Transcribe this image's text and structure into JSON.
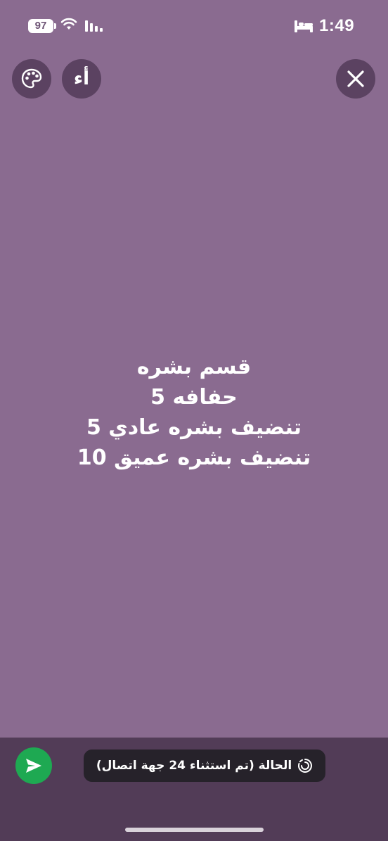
{
  "status_bar": {
    "battery_level": "97",
    "time": "1:49",
    "icons": [
      "wifi-icon",
      "signal-icon",
      "sleep-focus-icon"
    ]
  },
  "toolbar": {
    "font_button_label": "أء",
    "palette_icon": "palette-icon",
    "close_icon": "close-icon"
  },
  "status_text": {
    "lines": [
      "قسم بشره",
      "حفافه 5",
      "تنضيف بشره عادي 5",
      "تنضيف بشره عميق 10"
    ]
  },
  "bottom": {
    "audience_label": "الحالة (تم استثناء 24 جهة اتصال)",
    "audience_icon": "status-ring-icon",
    "send_icon": "send-icon"
  },
  "colors": {
    "background": "#8a6b90",
    "bottom_bar": "#523c57",
    "button_bg": "#5b4261",
    "send_green": "#1ea952",
    "pill_bg": "#26222a"
  }
}
